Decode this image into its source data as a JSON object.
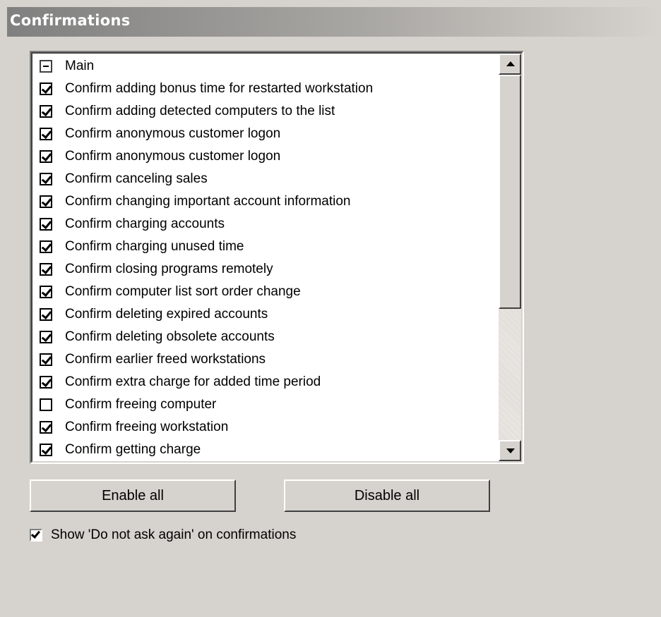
{
  "panel": {
    "title": "Confirmations"
  },
  "list": {
    "group": {
      "label": "Main",
      "expanded": true
    },
    "items": [
      {
        "label": "Confirm adding bonus time for restarted workstation",
        "checked": true
      },
      {
        "label": "Confirm adding detected computers to the list",
        "checked": true
      },
      {
        "label": "Confirm anonymous customer logon",
        "checked": true
      },
      {
        "label": "Confirm anonymous customer logon",
        "checked": true
      },
      {
        "label": "Confirm canceling sales",
        "checked": true
      },
      {
        "label": "Confirm changing important account information",
        "checked": true
      },
      {
        "label": "Confirm charging accounts",
        "checked": true
      },
      {
        "label": "Confirm charging unused time",
        "checked": true
      },
      {
        "label": "Confirm closing programs remotely",
        "checked": true
      },
      {
        "label": "Confirm computer list sort order change",
        "checked": true
      },
      {
        "label": "Confirm deleting expired accounts",
        "checked": true
      },
      {
        "label": "Confirm deleting obsolete accounts",
        "checked": true
      },
      {
        "label": "Confirm earlier freed workstations",
        "checked": true
      },
      {
        "label": "Confirm extra charge for added time period",
        "checked": true
      },
      {
        "label": "Confirm freeing computer",
        "checked": false
      },
      {
        "label": "Confirm freeing workstation",
        "checked": true
      },
      {
        "label": "Confirm getting charge",
        "checked": true
      }
    ]
  },
  "buttons": {
    "enable_all": "Enable all",
    "disable_all": "Disable all"
  },
  "option": {
    "label": "Show 'Do not ask again' on confirmations",
    "checked": true
  },
  "colors": {
    "background": "#d6d3ce",
    "header_dark": "#808080",
    "list_bg": "#ffffff"
  }
}
